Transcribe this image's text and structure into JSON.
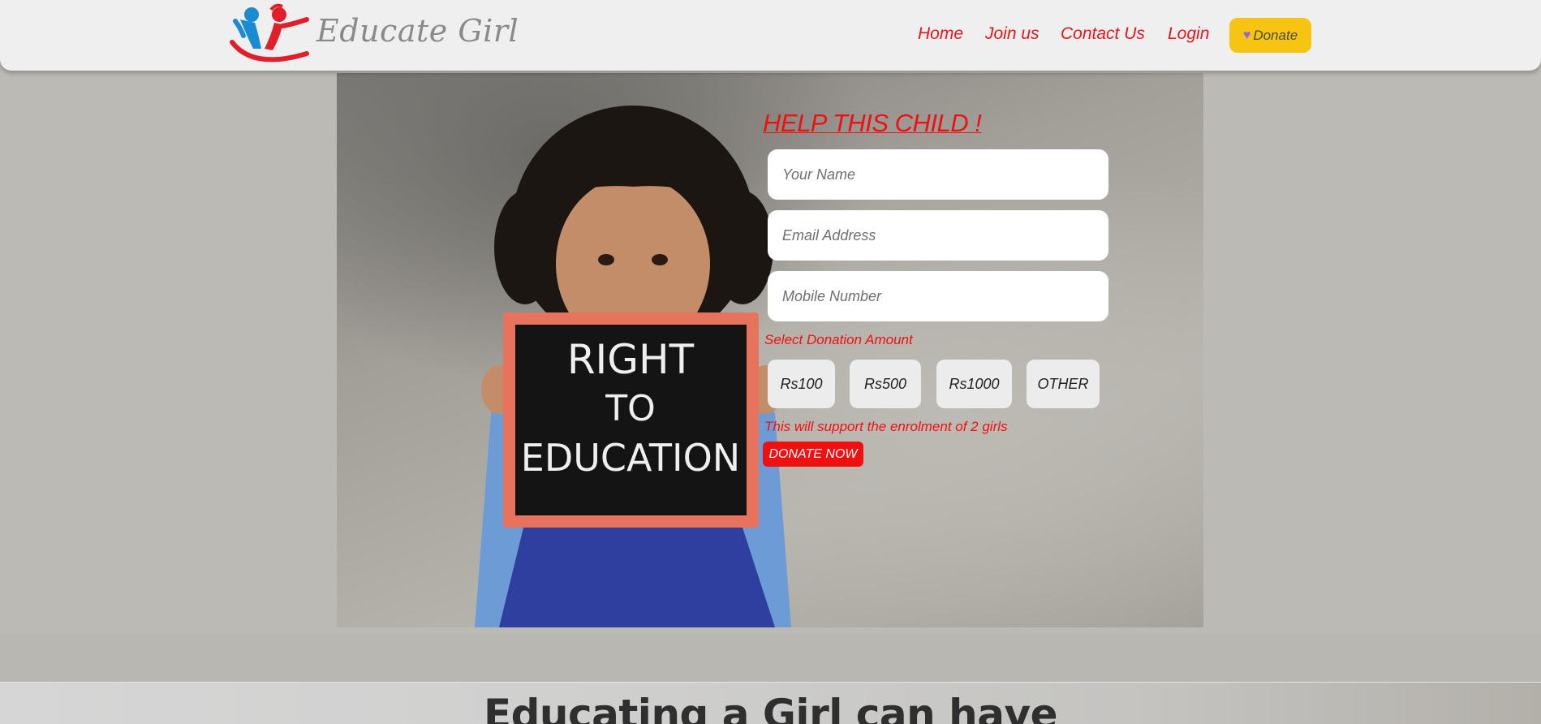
{
  "header": {
    "logo_text": "Educate Girl",
    "nav": [
      {
        "label": "Home"
      },
      {
        "label": "Join us"
      },
      {
        "label": "Contact Us"
      },
      {
        "label": "Login"
      }
    ],
    "donate_label": "Donate",
    "heart_icon": "purple-heart-icon"
  },
  "hero": {
    "chalkboard_lines": [
      "RIGHT",
      "TO",
      "EDUCATION"
    ]
  },
  "form": {
    "title": "HELP THIS CHILD !",
    "name_placeholder": "Your Name",
    "email_placeholder": "Email Address",
    "mobile_placeholder": "Mobile Number",
    "select_label": "Select Donation Amount",
    "amounts": [
      "Rs100",
      "Rs500",
      "Rs1000",
      "OTHER"
    ],
    "support_text": "This will support the enrolment of 2 girls",
    "donate_now_label": "DONATE NOW"
  },
  "section": {
    "heading": "Educating a Girl can have"
  },
  "colors": {
    "accent_red": "#f01010",
    "donate_yellow": "#f6c411",
    "page_gray": "#bcbab5"
  }
}
